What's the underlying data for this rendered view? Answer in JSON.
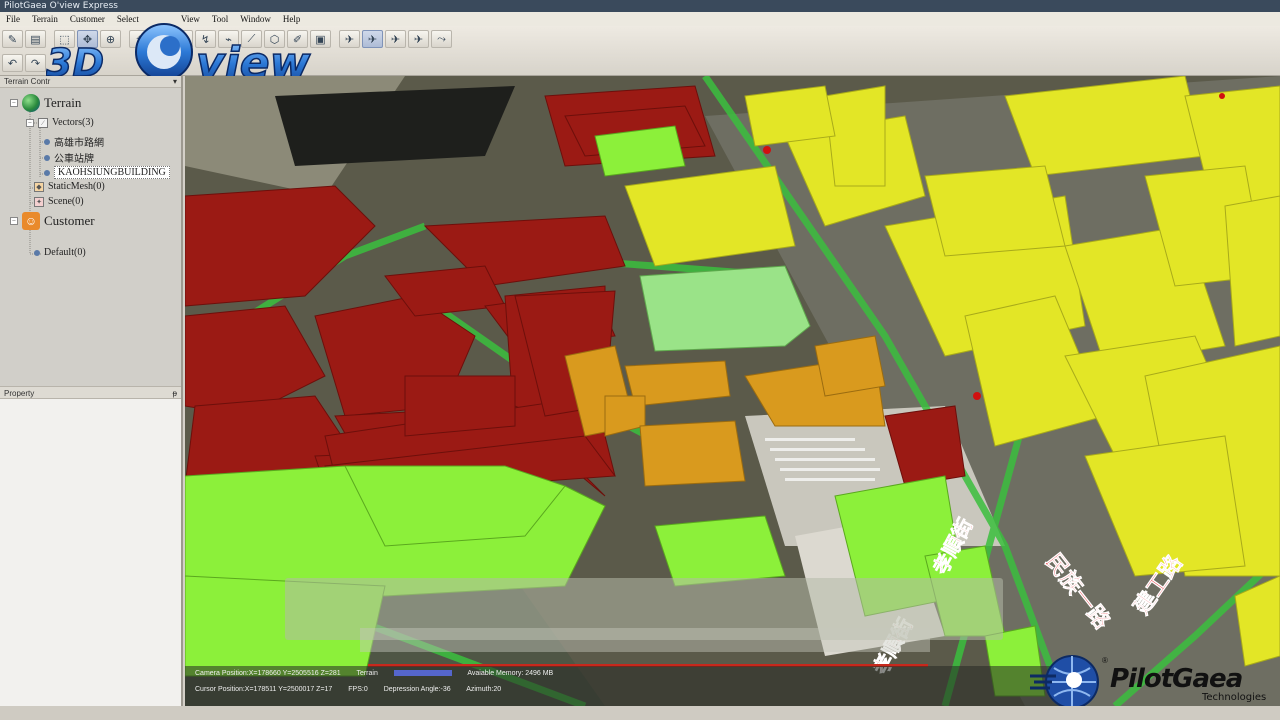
{
  "window": {
    "title": "PilotGaea O'view Express"
  },
  "menu": [
    "File",
    "Terrain",
    "Customer",
    "Select",
    "View",
    "Tool",
    "Window",
    "Help"
  ],
  "logo": {
    "prefix": "3D",
    "wordmark": "view"
  },
  "terrain_panel": {
    "title": "Terrain Contr",
    "pin": "▾"
  },
  "tree": {
    "terrain": "Terrain",
    "vectors": "Vectors(3)",
    "road": "高雄市路網",
    "bus": "公車站牌",
    "building": "KAOHSIUNGBUILDING",
    "static_mesh": "StaticMesh(0)",
    "scene": "Scene(0)",
    "customer": "Customer",
    "default": "Default(0)"
  },
  "property_panel": {
    "title": "Property",
    "pin": "ᵽ"
  },
  "status": {
    "camera": "Camera Position:X=178660 Y=2505516 Z=281",
    "terrain": "Terrain",
    "memory": "Avaiable Memory: 2496 MB",
    "cursor": "Cursor Position:X=178511 Y=2500017 Z=17",
    "fps": "FPS:0",
    "depression": "Depression Angle:-36",
    "azimuth": "Azimuth:20"
  },
  "street_labels": [
    "民族一路",
    "建工路",
    "孝順街",
    "孝順街"
  ],
  "brand": {
    "name": "PilotGaea",
    "sub": "Technologies",
    "reg": "®"
  },
  "colors": {
    "red_buildings": "#9b1a14",
    "yellow_buildings": "#e3e626",
    "green_buildings": "#8cf03a",
    "orange_buildings": "#d99a1e",
    "roads": "#3bbf3e",
    "logo_blue": "#1f63b7"
  }
}
